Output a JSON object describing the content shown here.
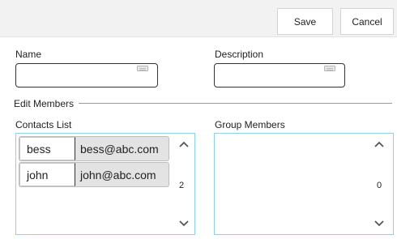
{
  "toolbar": {
    "save_label": "Save",
    "cancel_label": "Cancel"
  },
  "form": {
    "name_label": "Name",
    "name_value": "",
    "description_label": "Description",
    "description_value": "",
    "edit_members_label": "Edit Members"
  },
  "contacts": {
    "label": "Contacts List",
    "count": "2",
    "items": [
      {
        "name": "bess",
        "email": "bess@abc.com"
      },
      {
        "name": "john",
        "email": "john@abc.com"
      }
    ]
  },
  "group_members": {
    "label": "Group Members",
    "count": "0",
    "items": []
  },
  "icons": {
    "keyboard": "keyboard-icon",
    "scroll_up": "chevron-up-icon",
    "scroll_down": "chevron-down-icon"
  },
  "colors": {
    "toolbar_bg": "#f2f2f2",
    "listbox_border": "#8bd2f0"
  }
}
